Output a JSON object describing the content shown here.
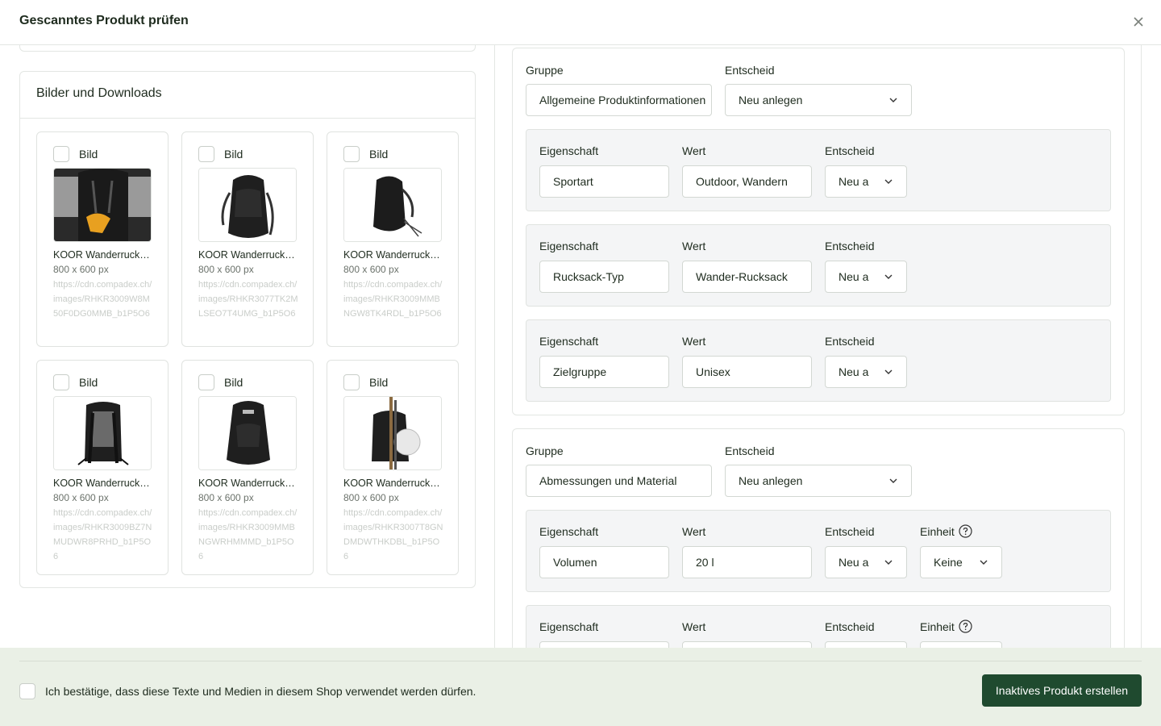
{
  "header": {
    "title": "Gescanntes Produkt prüfen"
  },
  "media": {
    "title": "Bilder und Downloads",
    "tiles": [
      {
        "label": "Bild",
        "name": "KOOR Wanderrucksack",
        "size": "800 x 600 px",
        "url": "https://cdn.compadex.ch/images/RHKR3009W8M50F0DG0MMB_b1P5O6"
      },
      {
        "label": "Bild",
        "name": "KOOR Wanderrucksack",
        "size": "800 x 600 px",
        "url": "https://cdn.compadex.ch/images/RHKR3077TK2MLSEO7T4UMG_b1P5O6"
      },
      {
        "label": "Bild",
        "name": "KOOR Wanderrucksack",
        "size": "800 x 600 px",
        "url": "https://cdn.compadex.ch/images/RHKR3009MMBNGW8TK4RDL_b1P5O6"
      },
      {
        "label": "Bild",
        "name": "KOOR Wanderrucksack",
        "size": "800 x 600 px",
        "url": "https://cdn.compadex.ch/images/RHKR3009BZ7NMUDWR8PRHD_b1P5O6"
      },
      {
        "label": "Bild",
        "name": "KOOR Wanderrucksack",
        "size": "800 x 600 px",
        "url": "https://cdn.compadex.ch/images/RHKR3009MMBNGWRHMMMD_b1P5O6"
      },
      {
        "label": "Bild",
        "name": "KOOR Wanderrucksack",
        "size": "800 x 600 px",
        "url": "https://cdn.compadex.ch/images/RHKR3007T8GNDMDWTHKDBL_b1P5O6"
      }
    ]
  },
  "groups": [
    {
      "group_label": "Gruppe",
      "group_value": "Allgemeine Produktinformationen",
      "decision_label": "Entscheid",
      "decision_value": "Neu anlegen",
      "props": [
        {
          "prop_label": "Eigenschaft",
          "prop_value": "Sportart",
          "value_label": "Wert",
          "value": "Outdoor, Wandern",
          "decision_label": "Entscheid",
          "decision_value": "Neu a"
        },
        {
          "prop_label": "Eigenschaft",
          "prop_value": "Rucksack-Typ",
          "value_label": "Wert",
          "value": "Wander-Rucksack",
          "decision_label": "Entscheid",
          "decision_value": "Neu a"
        },
        {
          "prop_label": "Eigenschaft",
          "prop_value": "Zielgruppe",
          "value_label": "Wert",
          "value": "Unisex",
          "decision_label": "Entscheid",
          "decision_value": "Neu a"
        }
      ]
    },
    {
      "group_label": "Gruppe",
      "group_value": "Abmessungen und Material",
      "decision_label": "Entscheid",
      "decision_value": "Neu anlegen",
      "props": [
        {
          "prop_label": "Eigenschaft",
          "prop_value": "Volumen",
          "value_label": "Wert",
          "value": "20 l",
          "decision_label": "Entscheid",
          "decision_value": "Neu a",
          "unit_label": "Einheit",
          "unit_value": "Keine"
        },
        {
          "prop_label": "Eigenschaft",
          "prop_value": "",
          "value_label": "Wert",
          "value": "",
          "decision_label": "Entscheid",
          "decision_value": "",
          "unit_label": "Einheit",
          "unit_value": ""
        }
      ]
    }
  ],
  "footer": {
    "confirm_text": "Ich bestätige, dass diese Texte und Medien in diesem Shop verwendet werden dürfen.",
    "primary_button": "Inaktives Produkt erstellen"
  },
  "colors": {
    "primary": "#1f4a2f",
    "footer_bg": "#eaf0e6",
    "prop_bg": "#f4f5f6"
  },
  "icons": {
    "close": "close-icon",
    "chevron": "chevron-down-icon",
    "help": "question-circle-icon"
  }
}
